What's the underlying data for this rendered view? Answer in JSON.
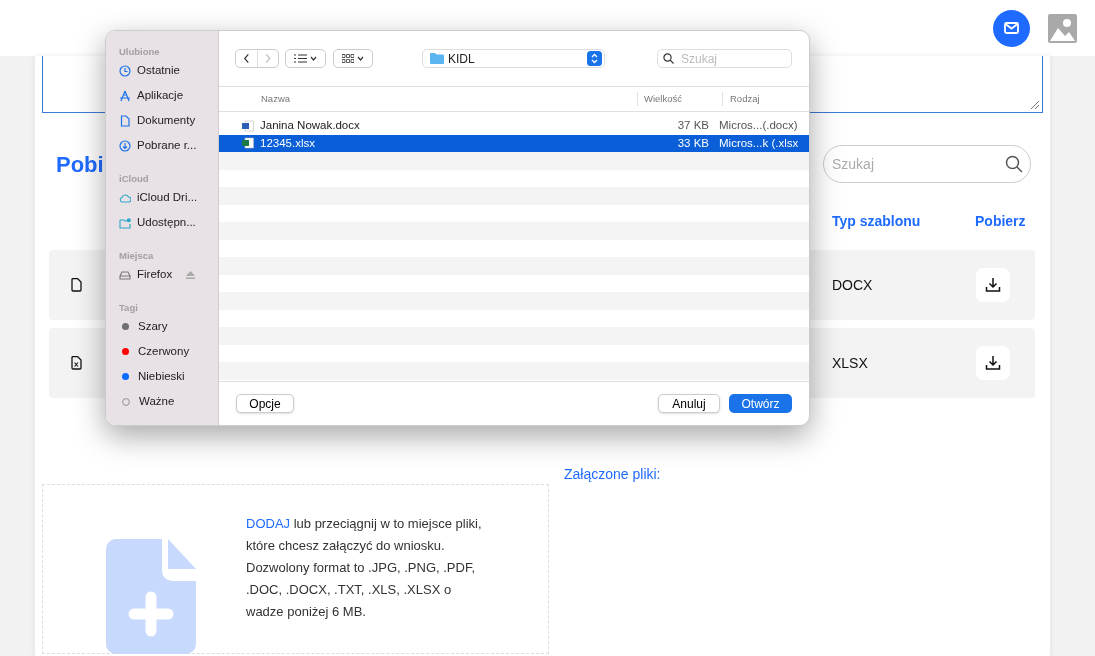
{
  "templates": {
    "heading": "Pobi",
    "search": {
      "placeholder": "Szukaj"
    },
    "columns": [
      "Typ szablonu",
      "Pobierz"
    ],
    "rows": [
      {
        "kind": "doc",
        "type": "DOCX"
      },
      {
        "kind": "xls",
        "type": "XLSX"
      }
    ]
  },
  "attachments": {
    "title": "Załączone pliki:",
    "dropzone_text": "**DODAJ** lub przeciągnij w to miejsce pliki, które chcesz załączyć do wniosku. Dozwolony format to .JPG, .PNG, .PDF, .DOC, .DOCX, .TXT, .XLS, .XLSX o wadze poniżej 6 MB."
  },
  "dialog": {
    "sidebar": [
      {
        "title": "Ulubione",
        "items": [
          {
            "kind": "clock",
            "label": "Ostatnie"
          },
          {
            "kind": "apps",
            "label": "Aplikacje"
          },
          {
            "kind": "doc",
            "label": "Dokumenty"
          },
          {
            "kind": "download",
            "label": "Pobrane r..."
          }
        ]
      },
      {
        "title": "iCloud",
        "items": [
          {
            "kind": "cloud",
            "label": "iCloud Dri..."
          },
          {
            "kind": "shared",
            "label": "Udostępn..."
          }
        ]
      },
      {
        "title": "Miejsca",
        "items": [
          {
            "kind": "drive",
            "label": "Firefox",
            "eject": true
          }
        ]
      },
      {
        "title": "Tagi",
        "items": [
          {
            "kind": "tag",
            "label": "Szary",
            "color": "#6e6e73"
          },
          {
            "kind": "tag",
            "label": "Czerwony",
            "color": "#ff0000"
          },
          {
            "kind": "tag",
            "label": "Niebieski",
            "color": "#0a6cff"
          },
          {
            "kind": "tagempty",
            "label": "Ważne"
          }
        ]
      }
    ],
    "folder": "KIDL",
    "search": {
      "placeholder": "Szukaj"
    },
    "columns": [
      "Nazwa",
      "Wielkość",
      "Rodzaj"
    ],
    "files": [
      {
        "kind": "docx",
        "name": "Janina Nowak.docx",
        "size": "37 KB",
        "type": "Micros...(.docx)",
        "selected": false
      },
      {
        "kind": "xlsx",
        "name": "12345.xlsx",
        "size": "33 KB",
        "type": "Micros...k (.xlsx",
        "selected": true
      }
    ],
    "buttons": {
      "options": "Opcje",
      "cancel": "Anuluj",
      "open": "Otwórz"
    }
  }
}
